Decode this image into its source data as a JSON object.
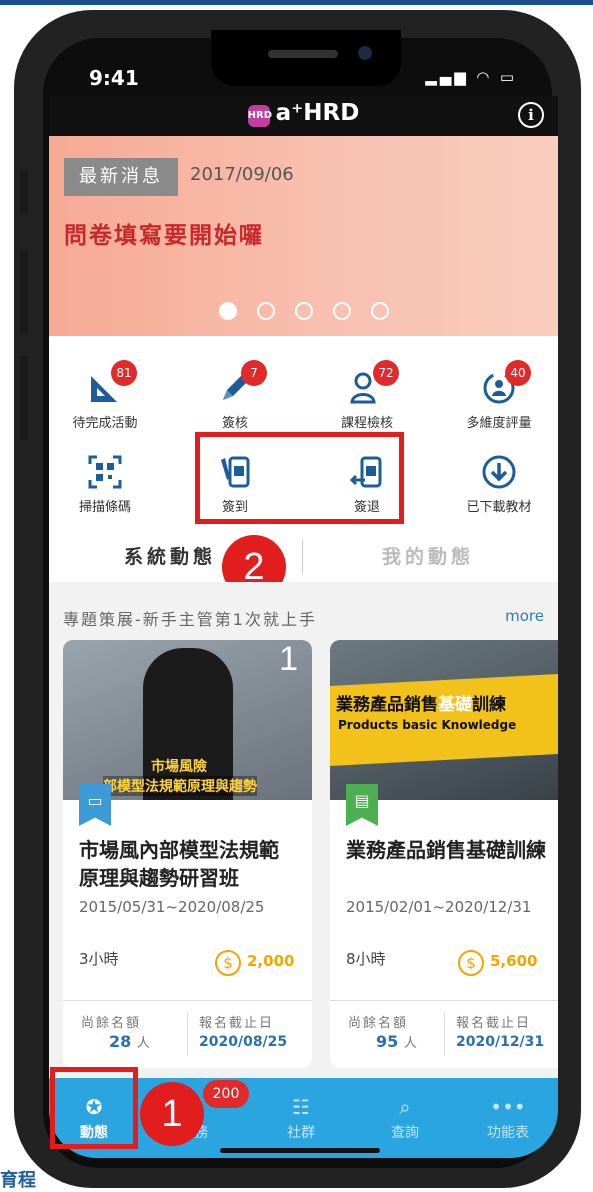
{
  "status": {
    "time": "9:41",
    "icons": "▂▄▆ ◠ ▭"
  },
  "app": {
    "title": "a⁺HRD",
    "logo_text": "HRD"
  },
  "banner": {
    "tag": "最新消息",
    "date": "2017/09/06",
    "headline": "問卷填寫要開始囉",
    "slides": 5,
    "active_slide": 1
  },
  "functions": [
    {
      "label": "待完成活動",
      "icon": "triangle-ruler-icon",
      "badge": "81"
    },
    {
      "label": "簽核",
      "icon": "pencil-icon",
      "badge": "7"
    },
    {
      "label": "課程檢核",
      "icon": "people-check-icon",
      "badge": "72"
    },
    {
      "label": "多維度評量",
      "icon": "person-cycle-icon",
      "badge": "40"
    },
    {
      "label": "掃描條碼",
      "icon": "qr-scan-icon",
      "badge": ""
    },
    {
      "label": "簽到",
      "icon": "sign-in-icon",
      "badge": ""
    },
    {
      "label": "簽退",
      "icon": "sign-out-icon",
      "badge": ""
    },
    {
      "label": "已下載教材",
      "icon": "download-icon",
      "badge": ""
    }
  ],
  "tabs": {
    "system": "系統動態",
    "mine": "我的動態"
  },
  "markers": {
    "one": "1",
    "two": "2"
  },
  "section": {
    "title": "專題策展-新手主管第1次就上手",
    "more": "more"
  },
  "cards": [
    {
      "number": "1",
      "img_cap1": "市場風險",
      "img_cap2": "部模型法規範原理與趨勢",
      "title": "市場風內部模型法規範原理與趨勢研習班",
      "date": "2015/05/31~2020/08/25",
      "hours": "3小時",
      "price": "2,000",
      "quota_label": "尚餘名額",
      "quota": "28",
      "quota_unit": "人",
      "deadline_label": "報名截止日",
      "deadline": "2020/08/25",
      "flag_color": "#3c9bd6"
    },
    {
      "img_title_a": "業務產品銷售",
      "img_title_b": "基礎",
      "img_title_c": "訓練",
      "img_sub": "Products basic Knowledge",
      "title": "業務產品銷售基礎訓練",
      "date": "2015/02/01~2020/12/31",
      "hours": "8小時",
      "price": "5,600",
      "quota_label": "尚餘名額",
      "quota": "95",
      "quota_unit": "人",
      "deadline_label": "報名截止日",
      "deadline": "2020/12/31",
      "flag_color": "#4caf50"
    }
  ],
  "nav": [
    {
      "label": "動態",
      "icon": "star-icon",
      "active": true
    },
    {
      "label": "任務",
      "icon": "task-icon",
      "badge": "200"
    },
    {
      "label": "社群",
      "icon": "community-icon"
    },
    {
      "label": "查詢",
      "icon": "search-icon"
    },
    {
      "label": "功能表",
      "icon": "more-icon"
    }
  ],
  "footer_text": "育程"
}
